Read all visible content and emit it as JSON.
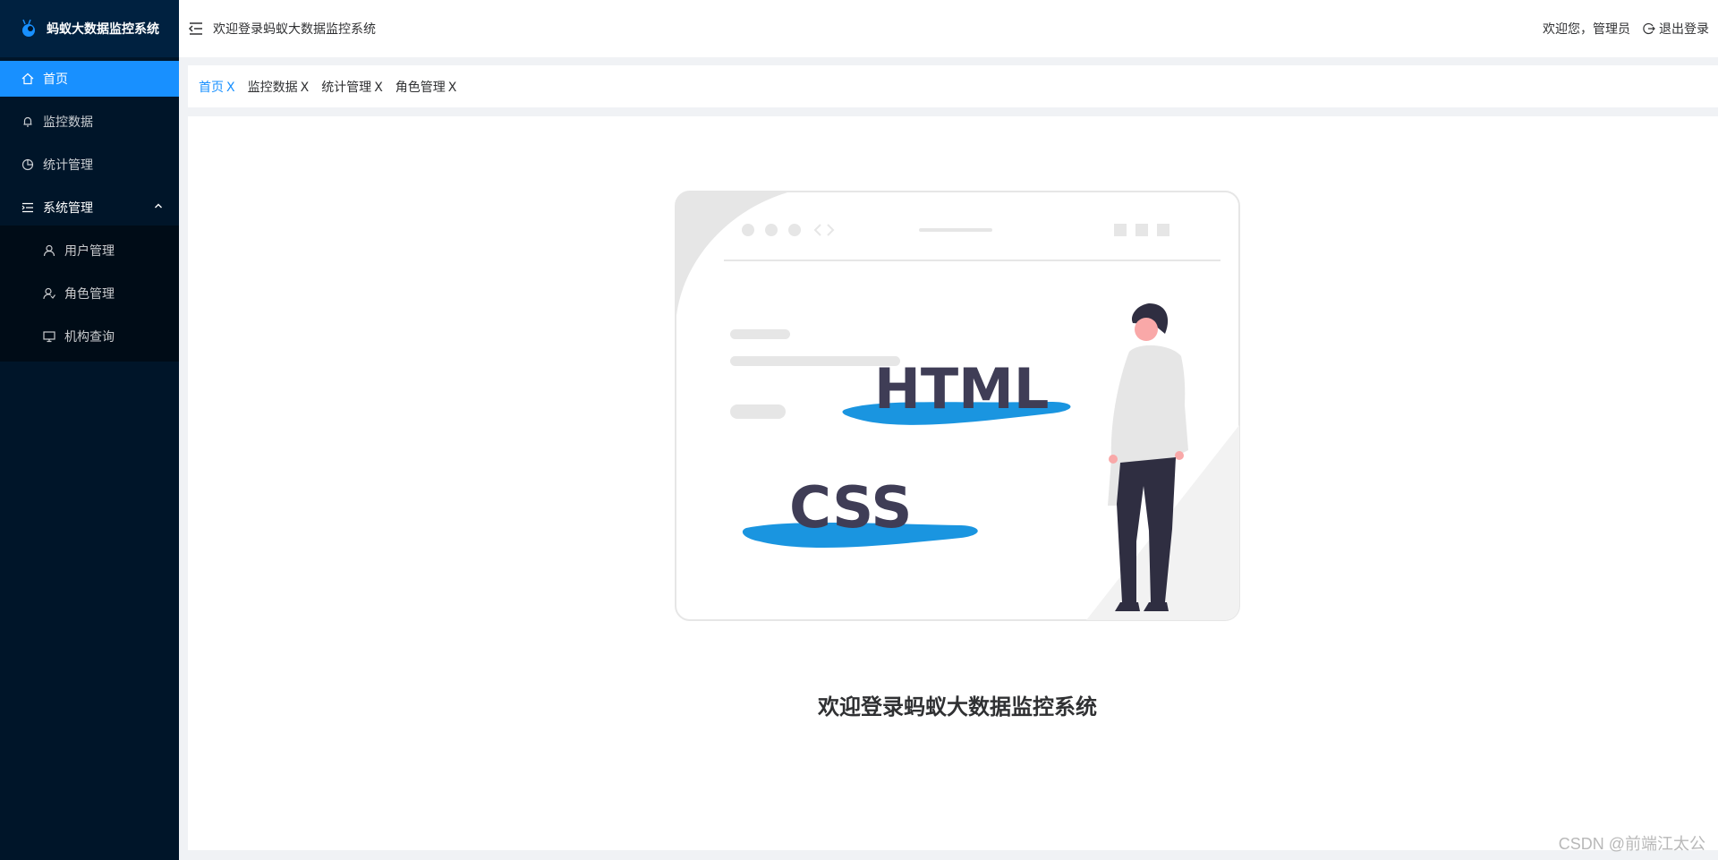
{
  "app": {
    "title": "蚂蚁大数据监控系统"
  },
  "sidebar": {
    "items": [
      {
        "label": "首页",
        "icon": "home-icon",
        "active": true
      },
      {
        "label": "监控数据",
        "icon": "bell-icon"
      },
      {
        "label": "统计管理",
        "icon": "pie-chart-icon"
      },
      {
        "label": "系统管理",
        "icon": "menu-list-icon",
        "expanded": true,
        "children": [
          {
            "label": "用户管理",
            "icon": "user-icon"
          },
          {
            "label": "角色管理",
            "icon": "role-icon"
          },
          {
            "label": "机构查询",
            "icon": "monitor-icon"
          }
        ]
      }
    ]
  },
  "header": {
    "title": "欢迎登录蚂蚁大数据监控系统",
    "user_greeting": "欢迎您，管理员",
    "logout_label": "退出登录"
  },
  "tabs": [
    {
      "label": "首页",
      "close": "X",
      "active": true
    },
    {
      "label": "监控数据",
      "close": "X"
    },
    {
      "label": "统计管理",
      "close": "X"
    },
    {
      "label": "角色管理",
      "close": "X"
    }
  ],
  "main": {
    "illustration": {
      "text_html": "HTML",
      "text_css": "CSS"
    },
    "welcome": "欢迎登录蚂蚁大数据监控系统"
  },
  "watermark": "CSDN @前端江太公",
  "colors": {
    "sidebar_bg": "#001529",
    "accent": "#1890ff",
    "illus_blue": "#1a95e0",
    "illus_dark": "#3f3d56"
  }
}
